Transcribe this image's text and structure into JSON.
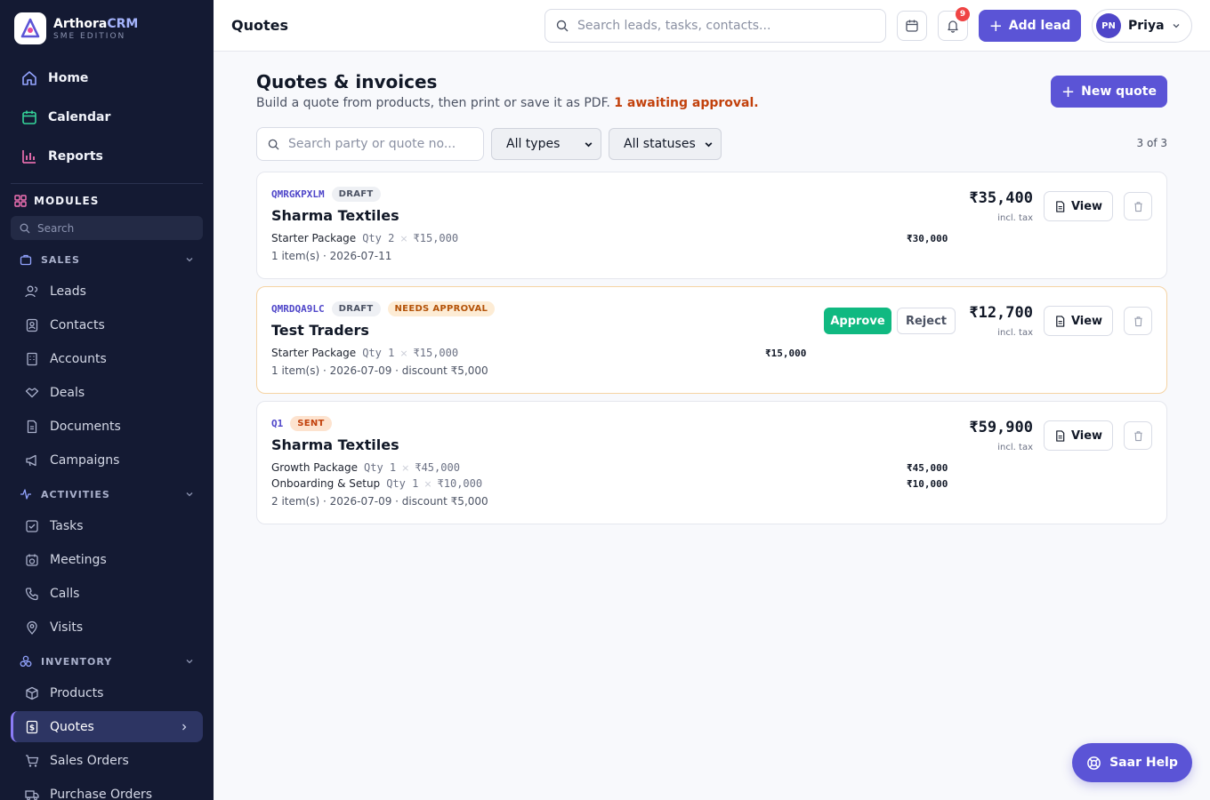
{
  "brand": {
    "name_main": "Arthora",
    "name_accent": "CRM",
    "edition": "SME EDITION"
  },
  "nav_top": [
    {
      "id": "home",
      "label": "Home",
      "icon": "home-icon",
      "color": "#93a4ff"
    },
    {
      "id": "calendar",
      "label": "Calendar",
      "icon": "calendar-icon",
      "color": "#34d399"
    },
    {
      "id": "reports",
      "label": "Reports",
      "icon": "bar-chart-icon",
      "color": "#f472b6"
    }
  ],
  "modules": {
    "title": "MODULES",
    "search_placeholder": "Search"
  },
  "groups": {
    "sales": {
      "title": "SALES",
      "items": [
        "Leads",
        "Contacts",
        "Accounts",
        "Deals",
        "Documents",
        "Campaigns"
      ]
    },
    "activities": {
      "title": "ACTIVITIES",
      "items": [
        "Tasks",
        "Meetings",
        "Calls",
        "Visits"
      ]
    },
    "inventory": {
      "title": "INVENTORY",
      "items": [
        "Products",
        "Quotes",
        "Sales Orders",
        "Purchase Orders"
      ],
      "active": "Quotes"
    }
  },
  "topbar": {
    "title": "Quotes",
    "search_placeholder": "Search leads, tasks, contacts...",
    "notifications_count": "9",
    "add_lead_label": "Add lead",
    "user_initials": "PN",
    "user_name": "Priya"
  },
  "page": {
    "title": "Quotes & invoices",
    "subtitle": "Build a quote from products, then print or save it as PDF.",
    "awaiting": "1 awaiting approval.",
    "new_quote_label": "New quote"
  },
  "filters": {
    "search_placeholder": "Search party or quote no...",
    "type_selected": "All types",
    "status_selected": "All statuses",
    "count": "3 of 3"
  },
  "quotes": [
    {
      "number": "QMRGKPXLM",
      "status": "DRAFT",
      "party": "Sharma Textiles",
      "lines": [
        {
          "product": "Starter Package",
          "qty": "Qty 2",
          "price": "₹15,000",
          "total": "₹30,000"
        }
      ],
      "meta": "1 item(s) · 2026-07-11",
      "total": "₹35,400",
      "tax_note": "incl. tax",
      "view_label": "View"
    },
    {
      "number": "QMRDQA9LC",
      "status": "DRAFT",
      "approval_badge": "NEEDS APPROVAL",
      "party": "Test Traders",
      "lines": [
        {
          "product": "Starter Package",
          "qty": "Qty 1",
          "price": "₹15,000",
          "total": "₹15,000"
        }
      ],
      "meta": "1 item(s) · 2026-07-09 · discount ₹5,000",
      "total": "₹12,700",
      "tax_note": "incl. tax",
      "approve_label": "Approve",
      "reject_label": "Reject",
      "view_label": "View"
    },
    {
      "number": "Q1",
      "status": "SENT",
      "party": "Sharma Textiles",
      "lines": [
        {
          "product": "Growth Package",
          "qty": "Qty 1",
          "price": "₹45,000",
          "total": "₹45,000"
        },
        {
          "product": "Onboarding & Setup",
          "qty": "Qty 1",
          "price": "₹10,000",
          "total": "₹10,000"
        }
      ],
      "meta": "2 item(s) · 2026-07-09 · discount ₹5,000",
      "total": "₹59,900",
      "tax_note": "incl. tax",
      "view_label": "View"
    }
  ],
  "help": {
    "label": "Saar Help"
  },
  "colors": {
    "accent": "#5b54d6",
    "sidebar": "#141a33",
    "approve": "#10b981",
    "warning": "#c2410c"
  }
}
